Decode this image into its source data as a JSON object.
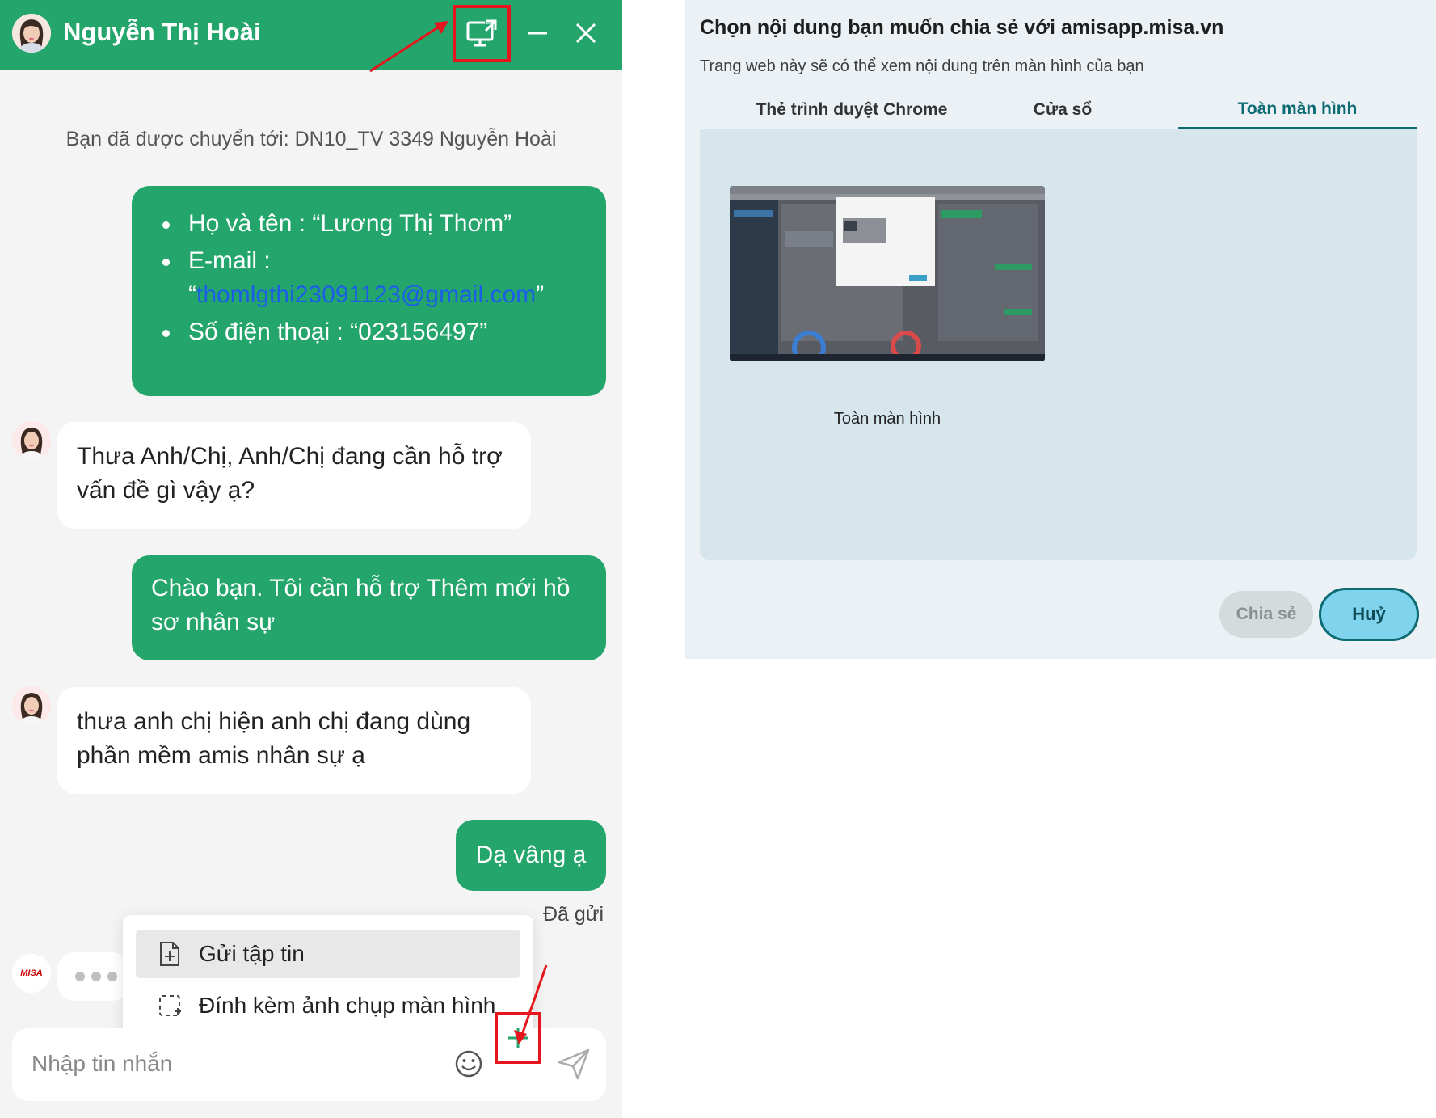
{
  "chat": {
    "header": {
      "agent_name": "Nguyễn Thị Hoài",
      "share_screen_icon": "screen-share-icon",
      "minimize_icon": "minimize-icon",
      "close_icon": "close-icon",
      "background_color": "#24a56c"
    },
    "system_message": "Bạn đã được chuyển tới: DN10_TV 3349 Nguyễn Hoài",
    "messages": {
      "customer_info": {
        "name_line": "Họ và tên : “Lương Thị Thơm”",
        "email_prefix": "E-mail :",
        "email_quote_open": "“",
        "email_value": "thomlgthi23091123@gmail.com",
        "email_quote_close": "”",
        "phone_line": "Số điện thoại : “023156497”"
      },
      "agent_1": "Thưa Anh/Chị, Anh/Chị đang cần hỗ trợ vấn đề gì vậy ạ?",
      "user_1": "Chào bạn. Tôi cần hỗ trợ Thêm mới hồ sơ nhân sự",
      "agent_2": "thưa anh chị hiện anh chị đang dùng phần mềm amis nhân sự ạ",
      "user_2": "Dạ vâng ạ"
    },
    "sent_status": "Đã gửi",
    "bot_avatar_label": "MISA",
    "attach_menu": {
      "send_file": "Gửi tập tin",
      "attach_screenshot": "Đính kèm ảnh chụp màn hình"
    },
    "input": {
      "placeholder": "Nhập tin nhắn",
      "value": ""
    },
    "highlight_color": "#e5161d"
  },
  "share_dialog": {
    "title": "Chọn nội dung bạn muốn chia sẻ với amisapp.misa.vn",
    "subtitle": "Trang web này sẽ có thể xem nội dung trên màn hình của bạn",
    "tabs": [
      {
        "label": "Thẻ trình duyệt Chrome",
        "active": false
      },
      {
        "label": "Cửa sổ",
        "active": false
      },
      {
        "label": "Toàn màn hình",
        "active": true
      }
    ],
    "thumbnail_label": "Toàn màn hình",
    "buttons": {
      "share": "Chia sẻ",
      "cancel": "Huỷ"
    },
    "accent_color": "#0c6a73"
  }
}
